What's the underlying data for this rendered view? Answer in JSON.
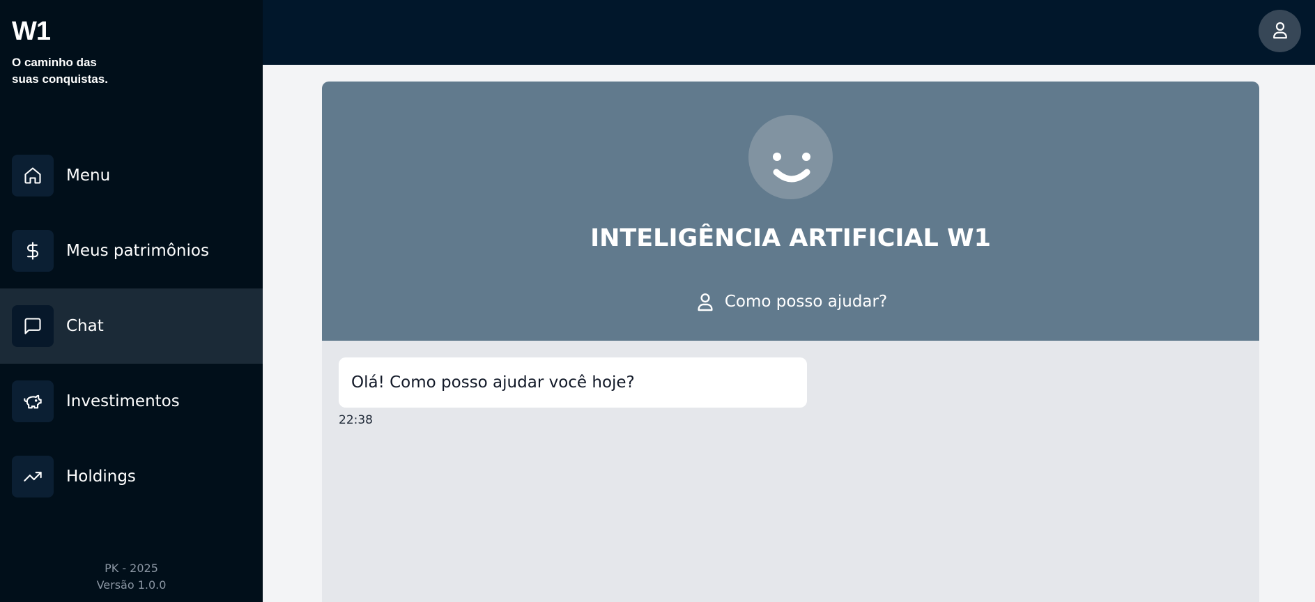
{
  "brand": {
    "logo": "W1",
    "tagline": "O caminho das suas conquistas."
  },
  "sidebar": {
    "items": [
      {
        "label": "Menu",
        "icon": "home-icon",
        "active": false
      },
      {
        "label": "Meus patrimônios",
        "icon": "dollar-icon",
        "active": false
      },
      {
        "label": "Chat",
        "icon": "chat-icon",
        "active": true
      },
      {
        "label": "Investimentos",
        "icon": "piggy-bank-icon",
        "active": false
      },
      {
        "label": "Holdings",
        "icon": "trending-up-icon",
        "active": false
      }
    ],
    "footer": {
      "copyright": "PK - 2025",
      "version": "Versão 1.0.0"
    }
  },
  "topbar": {
    "user_icon": "user-icon"
  },
  "chat": {
    "title": "INTELIGÊNCIA ARTIFICIAL W1",
    "subtitle": "Como posso ajudar?",
    "avatar_icon": "smile-icon",
    "messages": [
      {
        "text": "Olá! Como posso ajudar você hoje?",
        "time": "22:38",
        "sender": "bot"
      }
    ]
  },
  "colors": {
    "sidebar_bg": "#010f1a",
    "topbar_bg": "#01172b",
    "header_bg": "#617a8d",
    "active_item_bg": "#1b2a37"
  }
}
